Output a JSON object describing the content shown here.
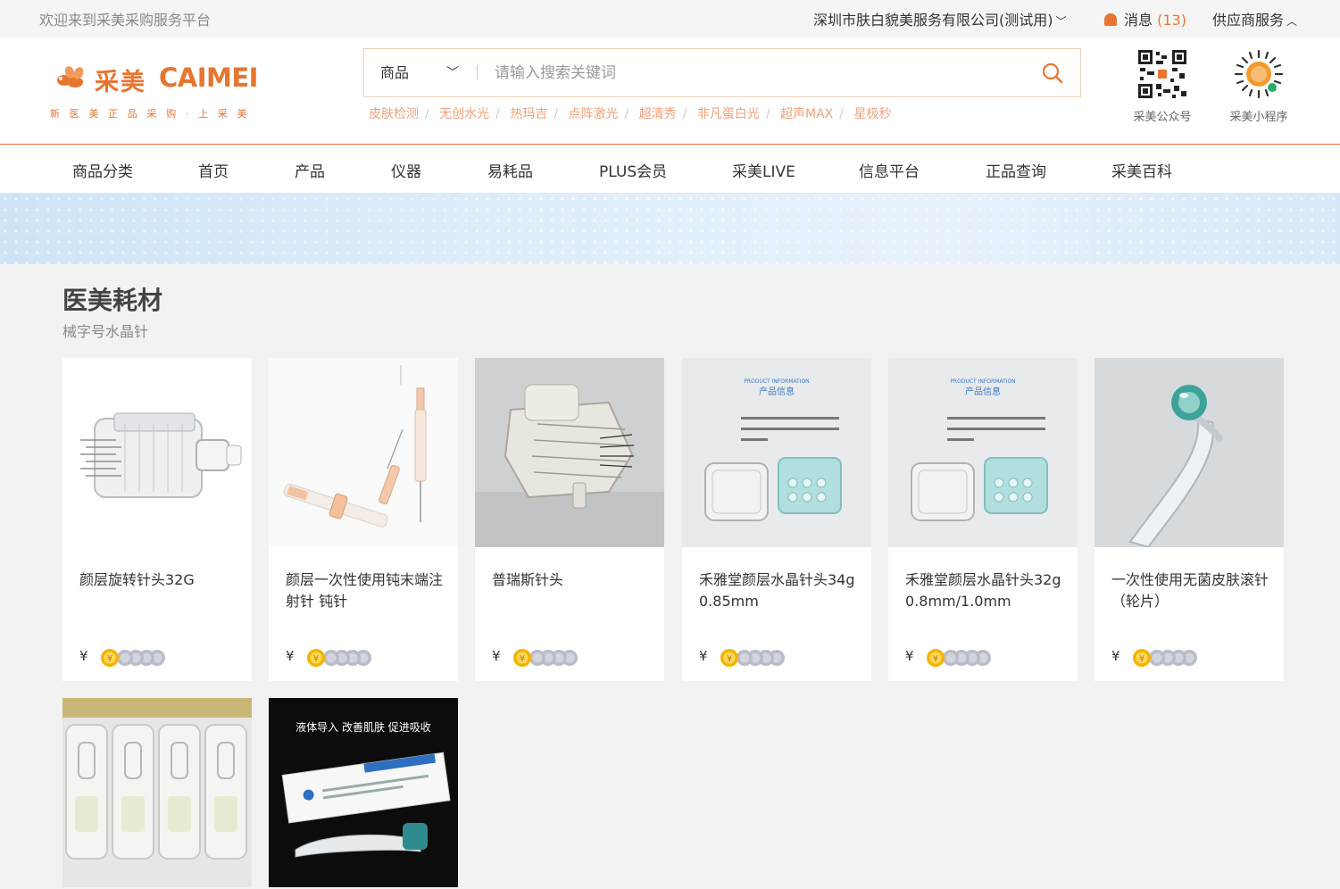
{
  "topbar": {
    "welcome": "欢迎来到采美采购服务平台",
    "company": "深圳市肤白貌美服务有限公司(测试用)",
    "messages_label": "消息",
    "messages_count": "(13)",
    "supplier": "供应商服务"
  },
  "logo": {
    "brand_cn": "采美",
    "brand_en": "CAIMEI",
    "slogan": "新医美正品采购·上采美"
  },
  "search": {
    "category": "商品",
    "placeholder": "请输入搜索关键词",
    "value": ""
  },
  "hot_tags": [
    "皮肤检测",
    "无创水光",
    "热玛吉",
    "点阵激光",
    "超清秀",
    "非凡蛋白光",
    "超声MAX",
    "星极秒"
  ],
  "qr_codes": [
    {
      "label": "采美公众号"
    },
    {
      "label": "采美小程序"
    }
  ],
  "nav": [
    "商品分类",
    "首页",
    "产品",
    "仪器",
    "易耗品",
    "PLUS会员",
    "采美LIVE",
    "信息平台",
    "正品查询",
    "采美百科"
  ],
  "section": {
    "title": "医美耗材",
    "subtitle": "械字号水晶针"
  },
  "products": [
    {
      "name": "颜层旋转针头32G",
      "price_symbol": "¥"
    },
    {
      "name": "颜层一次性使用钝末端注射针 钝针",
      "price_symbol": "¥"
    },
    {
      "name": "普瑞斯针头",
      "price_symbol": "¥"
    },
    {
      "name": "禾雅堂颜层水晶针头34g 0.85mm",
      "price_symbol": "¥"
    },
    {
      "name": "禾雅堂颜层水晶针头32g 0.8mm/1.0mm",
      "price_symbol": "¥"
    },
    {
      "name": "一次性使用无菌皮肤滚针（轮片）",
      "price_symbol": "¥"
    },
    {
      "name": "",
      "price_symbol": ""
    },
    {
      "name": "",
      "price_symbol": "",
      "image_caption": "液体导入 改善肌肤 促进吸收"
    }
  ],
  "image_text": {
    "product_info_en": "PRODUCT INFORMATION",
    "product_info_cn": "产品信息"
  },
  "colors": {
    "accent": "#e8752f",
    "hot_tag": "#f2a07a",
    "coin_gold": "#f5b400",
    "coin_grey": "#b9bcc8"
  }
}
